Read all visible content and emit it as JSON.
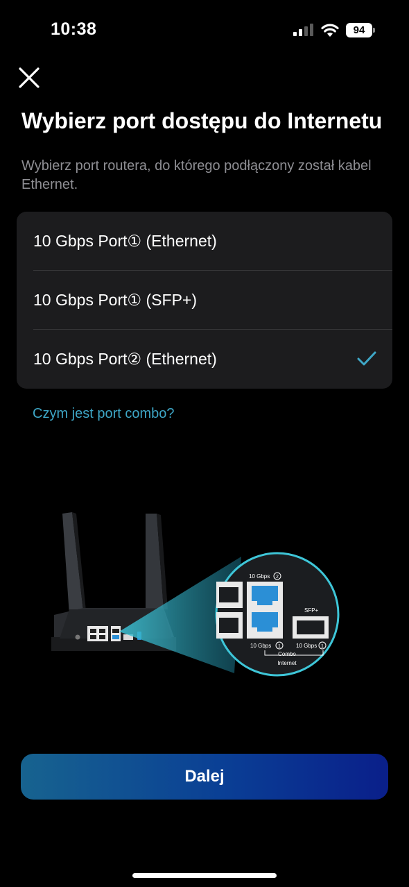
{
  "status_bar": {
    "time": "10:38",
    "battery": "94",
    "icons": [
      "signal-icon",
      "wifi-icon",
      "battery-icon"
    ]
  },
  "header": {
    "close_icon": "close-icon",
    "title": "Wybierz port dostępu do Internetu",
    "subtitle": "Wybierz port routera, do którego podłączony został kabel Ethernet."
  },
  "ports": {
    "options": [
      {
        "label": "10 Gbps Port① (Ethernet)",
        "selected": false
      },
      {
        "label": "10 Gbps Port① (SFP+)",
        "selected": false
      },
      {
        "label": "10 Gbps Port② (Ethernet)",
        "selected": true
      }
    ],
    "check_icon": "checkmark-icon"
  },
  "help_link": "Czym jest port combo?",
  "illustration": {
    "port2_label": "10 Gbps",
    "port2_number": "2",
    "port1_label": "10 Gbps",
    "port1_number": "1",
    "sfp_header": "SFP+",
    "sfp_label": "10 Gbps",
    "sfp_number": "1",
    "combo_label": "Combo",
    "internet_label": "Internet"
  },
  "next_button": {
    "label": "Dalej"
  },
  "colors": {
    "accent": "#3ea6c6",
    "list_background": "#1c1c1e",
    "button_gradient_start": "#17638f",
    "button_gradient_end": "#0a1f8a",
    "port_highlight": "#2b8fd6"
  }
}
